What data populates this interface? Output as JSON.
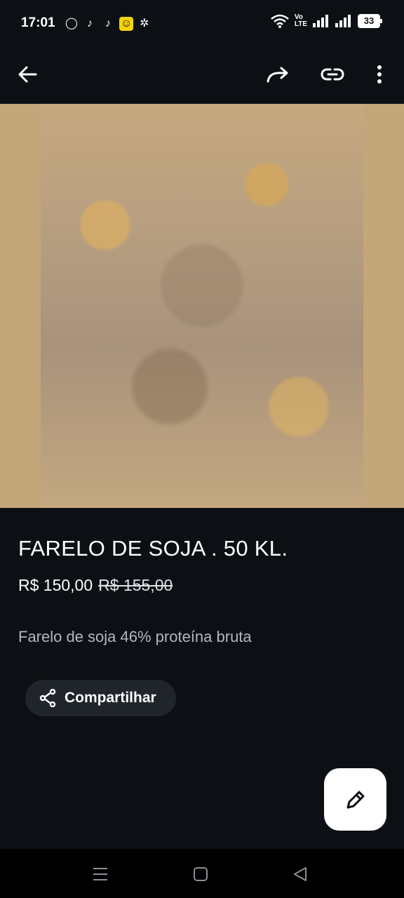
{
  "status_bar": {
    "time": "17:01",
    "network_label_top": "Vo",
    "network_label_bottom": "LTE",
    "battery": "33"
  },
  "app_bar": {
    "back_icon": "arrow-left-icon",
    "forward_icon": "share-forward-icon",
    "link_icon": "link-icon",
    "more_icon": "more-vert-icon"
  },
  "product": {
    "title": "FARELO DE SOJA . 50 KL.",
    "price": "R$ 150,00",
    "old_price": "R$ 155,00",
    "description": "Farelo de soja 46% proteína bruta",
    "share_label": "Compartilhar"
  },
  "colors": {
    "background": "#0c1014",
    "hero_bg": "#c3a679",
    "button_bg": "#20252b",
    "text_secondary": "#b3b8bf"
  }
}
